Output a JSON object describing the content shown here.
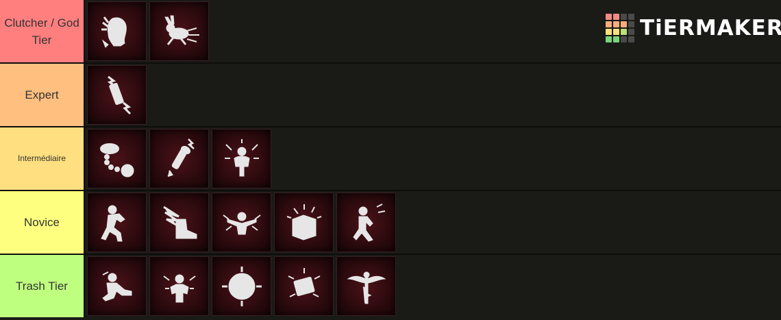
{
  "brand": {
    "name": "TiERMAKER",
    "grid_colors": [
      "#f28b82",
      "#f28b82",
      "#4a4a4a",
      "#4a4a4a",
      "#f6ae7b",
      "#f6ae7b",
      "#f6ae7b",
      "#4a4a4a",
      "#fbe27a",
      "#fbe27a",
      "#b8e07a",
      "#4a4a4a",
      "#7ad67a",
      "#7ad67a",
      "#4a4a4a",
      "#4a4a4a"
    ]
  },
  "tiers": [
    {
      "label": "Clutcher / God Tier",
      "color": "#ff7f7f",
      "items": [
        "head-trauma-icon",
        "sprinting-rabbit-icon"
      ]
    },
    {
      "label": "Expert",
      "color": "#ffbf7f",
      "items": [
        "syringe-lightning-icon"
      ]
    },
    {
      "label": "Intermédiaire",
      "color": "#ffdf7f",
      "items": [
        "ball-and-chain-icon",
        "flashlight-lightning-icon",
        "glowing-figure-icon"
      ]
    },
    {
      "label": "Novice",
      "color": "#ffff7f",
      "items": [
        "running-figure-icon",
        "winged-shoe-icon",
        "restrained-figure-icon",
        "pentagram-box-icon",
        "leaping-figure-icon"
      ]
    },
    {
      "label": "Trash Tier",
      "color": "#bfff7f",
      "items": [
        "crouching-figure-icon",
        "praying-figure-icon",
        "sun-box-icon",
        "medkit-icon",
        "winged-caduceus-icon"
      ]
    }
  ]
}
